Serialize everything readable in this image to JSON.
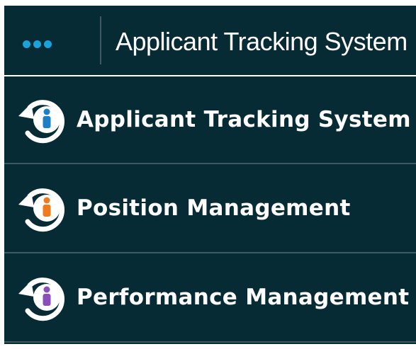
{
  "topbar": {
    "menu_icon": "more-dots-icon",
    "title": "Applicant Tracking System",
    "dot_color": "#1aa3d8"
  },
  "menu": {
    "items": [
      {
        "label": "Applicant Tracking System",
        "icon": "person-cycle-icon",
        "accent": "#1f7fc4"
      },
      {
        "label": "Position Management",
        "icon": "person-cycle-icon",
        "accent": "#f07b1f"
      },
      {
        "label": "Performance Management",
        "icon": "person-cycle-icon",
        "accent": "#8a4fb8"
      }
    ]
  },
  "colors": {
    "background": "#062b35",
    "divider": "#3d5a62",
    "text": "#ffffff"
  }
}
